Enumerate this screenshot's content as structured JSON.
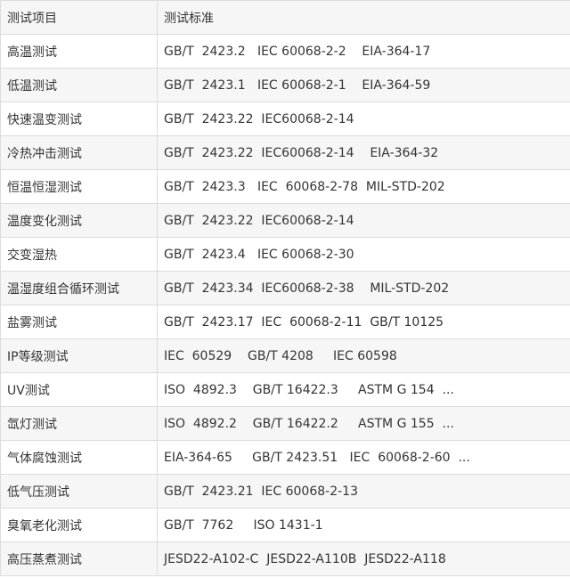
{
  "table": {
    "headers": [
      "测试项目",
      "测试标准"
    ],
    "rows": [
      [
        "高温测试",
        "GB/T  2423.2   IEC 60068-2-2    EIA-364-17"
      ],
      [
        "低温测试",
        "GB/T  2423.1   IEC 60068-2-1    EIA-364-59"
      ],
      [
        "快速温变测试",
        "GB/T  2423.22  IEC60068-2-14"
      ],
      [
        "冷热冲击测试",
        "GB/T  2423.22  IEC60068-2-14    EIA-364-32"
      ],
      [
        "恒温恒湿测试",
        "GB/T  2423.3   IEC  60068-2-78  MIL-STD-202"
      ],
      [
        "温度变化测试",
        "GB/T  2423.22  IEC60068-2-14"
      ],
      [
        "交变湿热",
        "GB/T  2423.4   IEC 60068-2-30"
      ],
      [
        "温湿度组合循环测试",
        "GB/T  2423.34  IEC60068-2-38    MIL-STD-202"
      ],
      [
        "盐雾测试",
        "GB/T  2423.17  IEC  60068-2-11  GB/T 10125"
      ],
      [
        "IP等级测试",
        "IEC  60529    GB/T 4208     IEC 60598"
      ],
      [
        "UV测试",
        "ISO  4892.3    GB/T 16422.3     ASTM G 154  ..."
      ],
      [
        "氙灯测试",
        "ISO  4892.2    GB/T 16422.2     ASTM G 155  ..."
      ],
      [
        "气体腐蚀测试",
        "EIA-364-65     GB/T 2423.51   IEC  60068-2-60  ..."
      ],
      [
        "低气压测试",
        "GB/T  2423.21  IEC 60068-2-13"
      ],
      [
        "臭氧老化测试",
        "GB/T  7762     ISO 1431-1"
      ],
      [
        "高压蒸煮测试",
        "JESD22-A102-C  JESD22-A110B  JESD22-A118"
      ]
    ]
  }
}
